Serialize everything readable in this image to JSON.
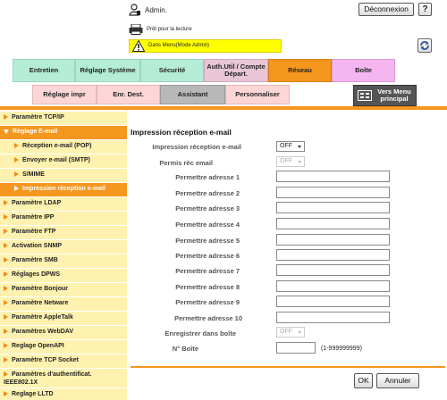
{
  "header": {
    "user_label": "Admin.",
    "logout_label": "Déconnexion",
    "help_label": "?",
    "status_text": "Prêt pour la lecture",
    "mode_text": "Dans Menu(Mode Admin)"
  },
  "tabs": [
    {
      "label": "Entretien"
    },
    {
      "label": "Réglage Système"
    },
    {
      "label": "Sécurité"
    },
    {
      "label": "Auth.Util / Compte Départ."
    },
    {
      "label": "Réseau",
      "active": true
    },
    {
      "label": "Boîte"
    }
  ],
  "subtabs": [
    {
      "label": "Réglage impr"
    },
    {
      "label": "Enr. Dest."
    },
    {
      "label": "Assistant"
    },
    {
      "label": "Personnaliser"
    }
  ],
  "main_menu_label": "Vers Menu principal",
  "sidebar": {
    "items": [
      {
        "label": "Paramètre TCP/IP"
      },
      {
        "label": "Réglage E-mail",
        "active": true,
        "open": true
      },
      {
        "label": "Réception e-mail (POP)",
        "sub": true
      },
      {
        "label": "Envoyer e-mail (SMTP)",
        "sub": true
      },
      {
        "label": "S/MIME",
        "sub": true
      },
      {
        "label": "Impression réception e-mail",
        "sub": true,
        "active": true
      },
      {
        "label": "Paramètre LDAP"
      },
      {
        "label": "Paramètre IPP"
      },
      {
        "label": "Paramètre FTP"
      },
      {
        "label": "Activation SNMP"
      },
      {
        "label": "Paramètre SMB"
      },
      {
        "label": "Réglages DPWS"
      },
      {
        "label": "Paramètre Bonjour"
      },
      {
        "label": "Paramètre Netware"
      },
      {
        "label": "Paramètre AppleTalk"
      },
      {
        "label": "Paramètres WebDAV"
      },
      {
        "label": "Reglage OpenAPI"
      },
      {
        "label": "Paramètre TCP Socket"
      },
      {
        "label": "Paramètres d'authentificat. IEEE802.1X"
      },
      {
        "label": "Reglage LLTD"
      }
    ]
  },
  "form": {
    "title": "Impression réception e-mail",
    "reception_label": "Impression réception e-mail",
    "reception_value": "OFF",
    "permit_label": "Permis rèc email",
    "permit_value": "OFF",
    "addresses": [
      {
        "label": "Permettre adresse 1",
        "value": ""
      },
      {
        "label": "Permettre adresse 2",
        "value": ""
      },
      {
        "label": "Permettre adresse 3",
        "value": ""
      },
      {
        "label": "Permettre adresse 4",
        "value": ""
      },
      {
        "label": "Permettre adresse 5",
        "value": ""
      },
      {
        "label": "Permettre adresse 6",
        "value": ""
      },
      {
        "label": "Permettre adresse 7",
        "value": ""
      },
      {
        "label": "Permettre adresse 8",
        "value": ""
      },
      {
        "label": "Permettre adresse 9",
        "value": ""
      },
      {
        "label": "Permettre adresse 10",
        "value": ""
      }
    ],
    "save_box_label": "Enregistrer dans boîte",
    "save_box_value": "OFF",
    "box_no_label": "N° Boîte",
    "box_no_value": "",
    "box_no_range": "(1-999999999)",
    "ok_label": "OK",
    "cancel_label": "Annuler"
  },
  "colors": {
    "accent": "#f5961e",
    "sidebar_bg": "#fff2b0",
    "mode_bar": "#ffff00"
  }
}
